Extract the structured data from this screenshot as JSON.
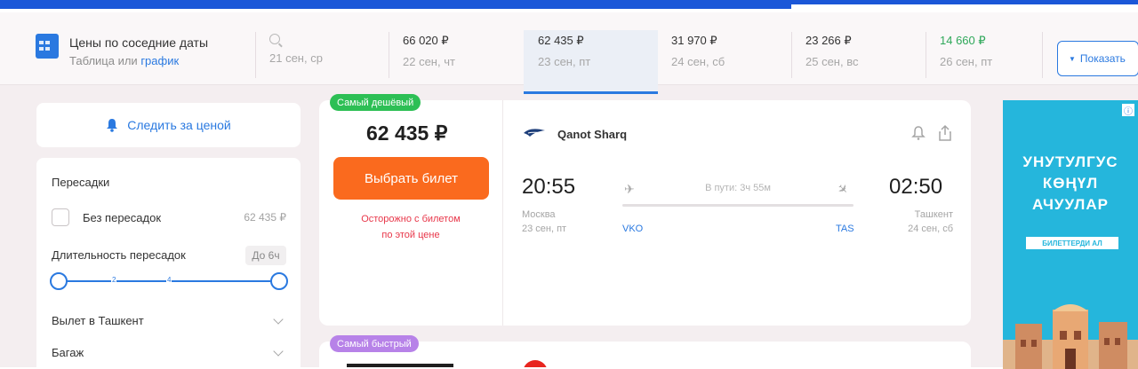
{
  "price_calendar": {
    "title": "Цены по соседние даты",
    "subtitle_prefix": "Таблица или ",
    "subtitle_link": "график",
    "search_date": "21 сен, ср",
    "days": [
      {
        "price": "66 020 ₽",
        "date": "22 сен, чт",
        "active": false
      },
      {
        "price": "62 435 ₽",
        "date": "23 сен, пт",
        "active": true
      },
      {
        "price": "31 970 ₽",
        "date": "24 сен, сб",
        "active": false
      },
      {
        "price": "23 266 ₽",
        "date": "25 сен, вс",
        "active": false
      },
      {
        "price": "14 660 ₽",
        "date": "26 сен, пт",
        "active": false,
        "color": "#2fa85a"
      }
    ],
    "show_button": "Показать"
  },
  "subscribe": {
    "label": "Следить за ценой"
  },
  "filters": {
    "transfers_title": "Пересадки",
    "no_transfers_label": "Без пересадок",
    "no_transfers_price": "62 435 ₽",
    "duration_label": "Длительность пересадок",
    "duration_pill": "До 6ч",
    "slider_ticks": [
      "2",
      "4"
    ],
    "rows": [
      "Вылет в Ташкент",
      "Багаж"
    ]
  },
  "ticket": {
    "badge": "Самый дешёвый",
    "price": "62 435 ₽",
    "buy_button": "Выбрать билет",
    "warning_line1": "Осторожно с билетом",
    "warning_line2": "по этой цене",
    "airline": "Qanot Sharq",
    "dep_time": "20:55",
    "dep_city": "Москва",
    "dep_date": "23 сен, пт",
    "dep_code": "VKO",
    "arr_time": "02:50",
    "arr_city": "Ташкент",
    "arr_date": "24 сен, сб",
    "arr_code": "TAS",
    "duration": "В пути: 3ч 55м"
  },
  "ticket2": {
    "badge": "Самый быстрый"
  },
  "ad": {
    "lines": [
      "УНУТУЛГУС",
      "КӨҢҮЛ",
      "АЧУУЛАР"
    ],
    "pill": "БИЛЕТТЕРДИ АЛ",
    "colors": {
      "background": "#25b6dc"
    }
  },
  "colors": {
    "accent": "#2a79e0",
    "cta": "#fa6a1e",
    "badge_green": "#2dbf55",
    "badge_purple": "#b782e8",
    "warning": "#e8374a"
  }
}
